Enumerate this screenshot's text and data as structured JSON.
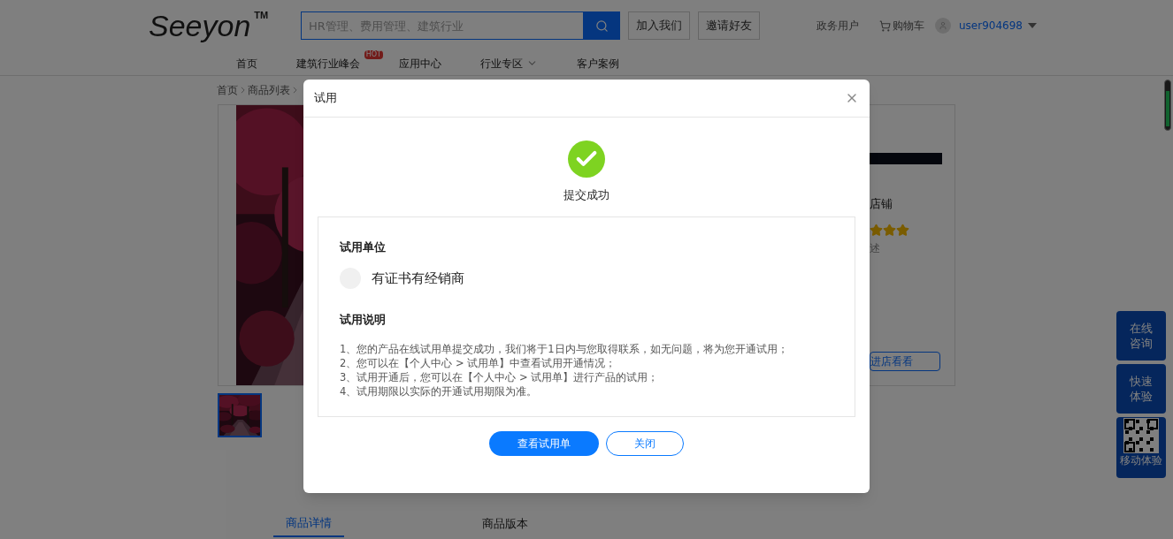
{
  "header": {
    "logo": "Seeyon",
    "trademark": "TM",
    "search": {
      "placeholder": "HR管理、费用管理、建筑行业"
    },
    "buttons": [
      "加入我们",
      "邀请好友"
    ],
    "links": [
      "政务用户",
      "购物车"
    ],
    "user": "user904698"
  },
  "nav": [
    {
      "label": "首页",
      "dropdown": false
    },
    {
      "label": "建筑行业峰会",
      "badge": "HOT",
      "dropdown": false
    },
    {
      "label": "应用中心",
      "dropdown": false
    },
    {
      "label": "行业专区",
      "dropdown": true
    },
    {
      "label": "客户案例",
      "dropdown": false
    }
  ],
  "breadcrumb": [
    "首页",
    "商品列表"
  ],
  "product": {
    "shop_label": "店铺",
    "stars": 3,
    "rating_label": "述",
    "shop_button": "进店看看"
  },
  "tabs": [
    {
      "label": "商品详情",
      "selected": true
    },
    {
      "label": "商品版本",
      "selected": false
    }
  ],
  "float_buttons": [
    {
      "kind": "text",
      "label": "在线咨询"
    },
    {
      "kind": "text",
      "label": "快速体验"
    },
    {
      "kind": "qr",
      "label": "移动体验"
    }
  ],
  "dialog": {
    "title": "试用",
    "status": "提交成功",
    "unit_heading": "试用单位",
    "unit_name": "有证书有经销商",
    "notes_heading": "试用说明",
    "notes": [
      "1、您的产品在线试用单提交成功，我们将于1日内与您取得联系，如无问题，将为您开通试用；",
      "2、您可以在【个人中心 > 试用单】中查看试用开通情况；",
      "3、试用开通后，您可以在【个人中心 > 试用单】进行产品的试用；",
      "4、试用期限以实际的开通试用期限为准。"
    ],
    "primary_button": "查看试用单",
    "secondary_button": "关闭"
  }
}
